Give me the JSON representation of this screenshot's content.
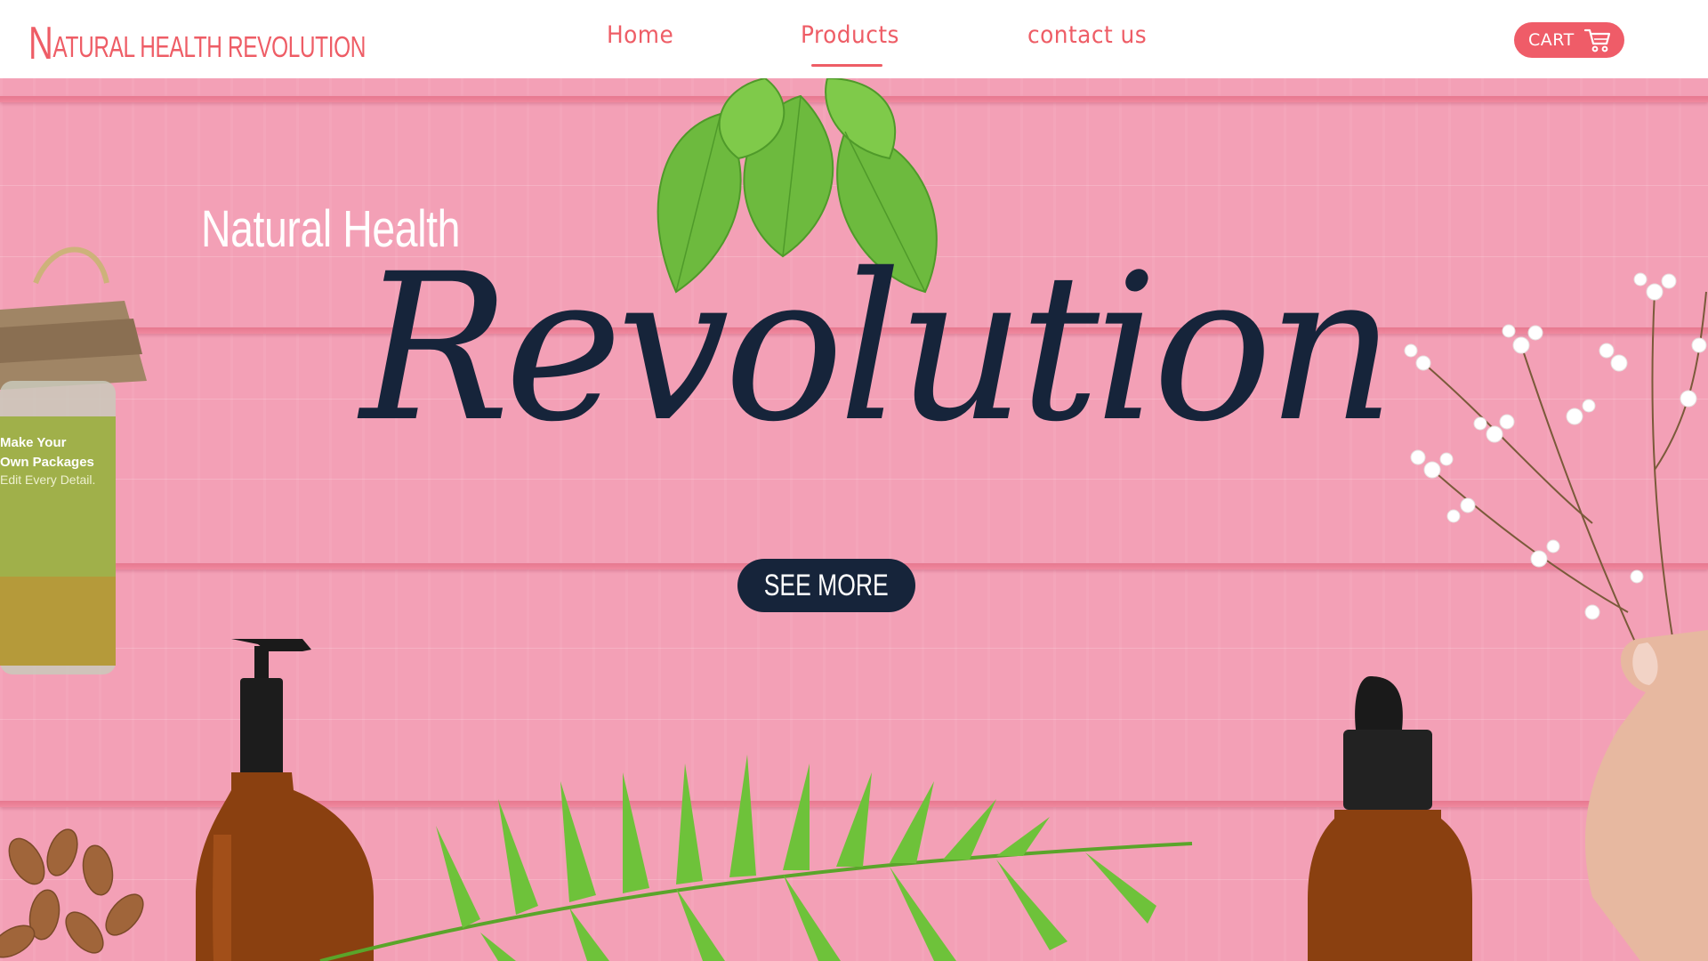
{
  "brand": {
    "logo_initial": "N",
    "logo_rest": "ATURAL HEALTH REVOLUTION",
    "color": "#ee5d66"
  },
  "nav": {
    "items": [
      {
        "label": "Home"
      },
      {
        "label": "Products",
        "active": true
      },
      {
        "label": "contact us"
      }
    ]
  },
  "cart": {
    "label": "CART",
    "icon": "shopping-cart-icon"
  },
  "hero": {
    "subtitle": "Natural Health",
    "title": "Revolution",
    "cta_label": "SEE MORE",
    "background_color": "#f3a0b6",
    "title_color": "#16243a"
  },
  "jar_label": {
    "line1": "Make Your",
    "line2": "Own Packages",
    "line3": "Edit Every Detail."
  }
}
